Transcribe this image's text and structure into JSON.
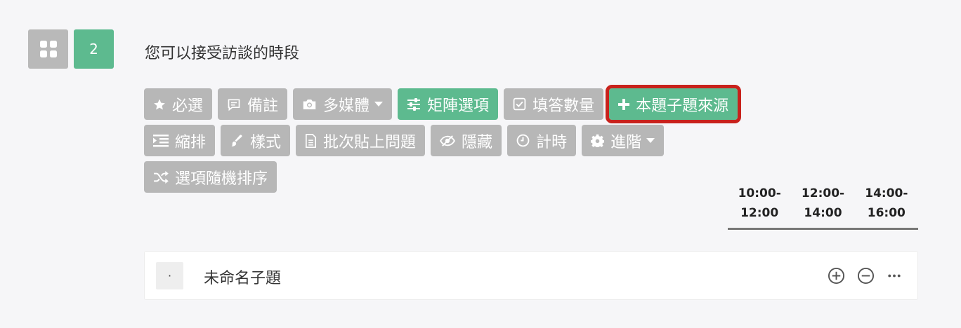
{
  "question": {
    "number": "2",
    "title": "您可以接受訪談的時段",
    "type_icon": "grid-icon"
  },
  "toolbar": {
    "row1": [
      {
        "label": "必選",
        "icon": "star-icon"
      },
      {
        "label": "備註",
        "icon": "comment-icon"
      },
      {
        "label": "多媒體",
        "icon": "camera-icon",
        "dropdown": true
      },
      {
        "label": "矩陣選項",
        "icon": "sliders-icon",
        "active": true
      },
      {
        "label": "填答數量",
        "icon": "checkbox-icon"
      },
      {
        "label": "本題子題來源",
        "icon": "plus-icon",
        "active": true,
        "highlighted": true
      },
      {
        "label": "縮排",
        "icon": "indent-icon"
      }
    ],
    "row2": [
      {
        "label": "樣式",
        "icon": "brush-icon"
      },
      {
        "label": "批次貼上問題",
        "icon": "document-icon"
      },
      {
        "label": "隱藏",
        "icon": "eye-slash-icon"
      },
      {
        "label": "計時",
        "icon": "clock-icon"
      },
      {
        "label": "進階",
        "icon": "gear-icon",
        "dropdown": true
      },
      {
        "label": "選項隨機排序",
        "icon": "shuffle-icon"
      }
    ]
  },
  "matrix": {
    "columns": [
      "10:00-\n12:00",
      "12:00-\n14:00",
      "14:00-\n16:00"
    ]
  },
  "subquestion": {
    "handle": "·",
    "label": "未命名子題",
    "actions": [
      "add-circle-icon",
      "remove-circle-icon",
      "more-icon"
    ]
  },
  "colors": {
    "green": "#5dba8f",
    "gray": "#b7b7b7",
    "highlight": "#c8221c"
  }
}
